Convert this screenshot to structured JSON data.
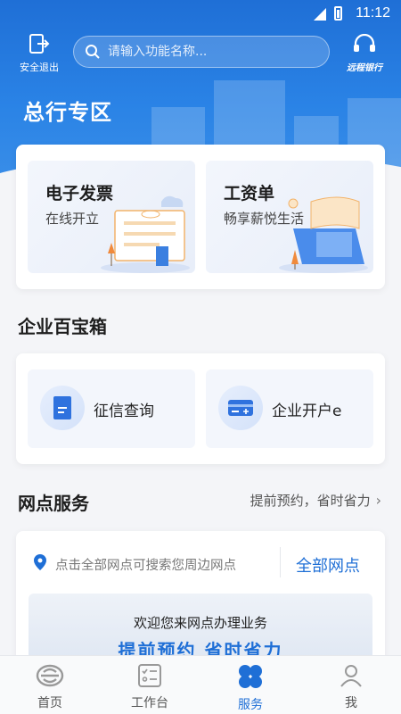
{
  "status_bar": {
    "time": "11:12"
  },
  "top_bar": {
    "exit_label": "安全退出",
    "search_placeholder": "请输入功能名称...",
    "remote_label": "远程银行"
  },
  "zone": {
    "title": "总行专区",
    "features": [
      {
        "title": "电子发票",
        "subtitle": "在线开立"
      },
      {
        "title": "工资单",
        "subtitle": "畅享薪悦生活"
      }
    ]
  },
  "toolbox": {
    "title": "企业百宝箱",
    "items": [
      {
        "label": "征信查询",
        "icon": "document-icon"
      },
      {
        "label": "企业开户e",
        "icon": "card-add-icon"
      }
    ]
  },
  "outlet": {
    "title": "网点服务",
    "more_label": "提前预约，省时省力",
    "location_hint": "点击全部网点可搜索您周边网点",
    "all_outlets": "全部网点",
    "banner_line1": "欢迎您来网点办理业务",
    "banner_line2": "提前预约 省时省力"
  },
  "bottom_nav": [
    {
      "label": "首页",
      "icon": "bank-logo-icon"
    },
    {
      "label": "工作台",
      "icon": "checklist-icon"
    },
    {
      "label": "服务",
      "icon": "grid-flower-icon"
    },
    {
      "label": "我",
      "icon": "person-icon"
    }
  ],
  "colors": {
    "brand_blue": "#1f6fd6",
    "background": "#f4f5f8"
  }
}
